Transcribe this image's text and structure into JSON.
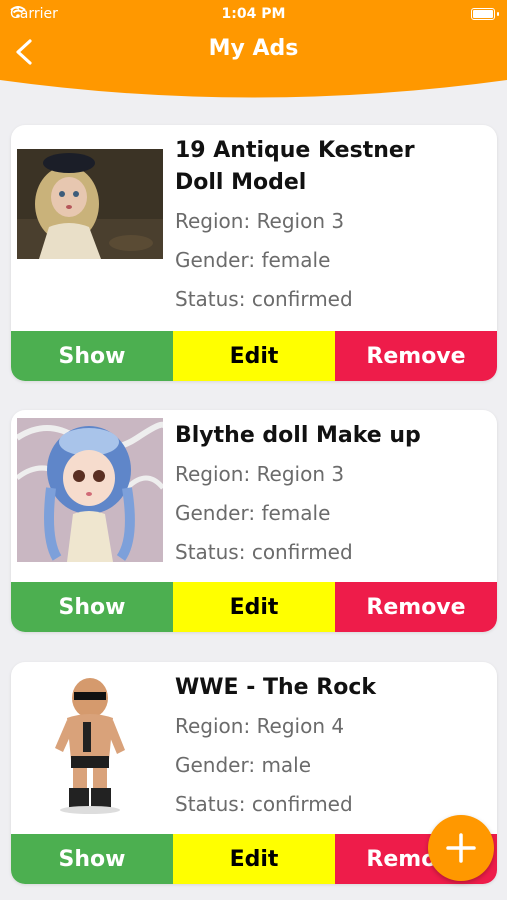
{
  "colors": {
    "header": "#ff9800",
    "show": "#4caf50",
    "edit": "#ffff00",
    "remove": "#ee1c4a",
    "fab": "#ff9800"
  },
  "status_bar": {
    "carrier": "Carrier",
    "time": "1:04 PM"
  },
  "header": {
    "title": "My Ads",
    "back_icon": "chevron-left-icon"
  },
  "ads": [
    {
      "title_line1": "19 Antique Kestner",
      "title_line2": "Doll Model",
      "region": "Region: Region 3",
      "gender": "Gender: female",
      "status": "Status: confirmed",
      "show_label": "Show",
      "edit_label": "Edit",
      "remove_label": "Remove"
    },
    {
      "title_line1": "Blythe doll Make up",
      "region": "Region: Region 3",
      "gender": "Gender: female",
      "status": "Status: confirmed",
      "show_label": "Show",
      "edit_label": "Edit",
      "remove_label": "Remove"
    },
    {
      "title_line1": "WWE - The Rock",
      "region": "Region: Region 4",
      "gender": "Gender: male",
      "status": "Status: confirmed",
      "show_label": "Show",
      "edit_label": "Edit",
      "remove_label": "Remove"
    }
  ],
  "fab": {
    "icon": "plus-icon"
  }
}
